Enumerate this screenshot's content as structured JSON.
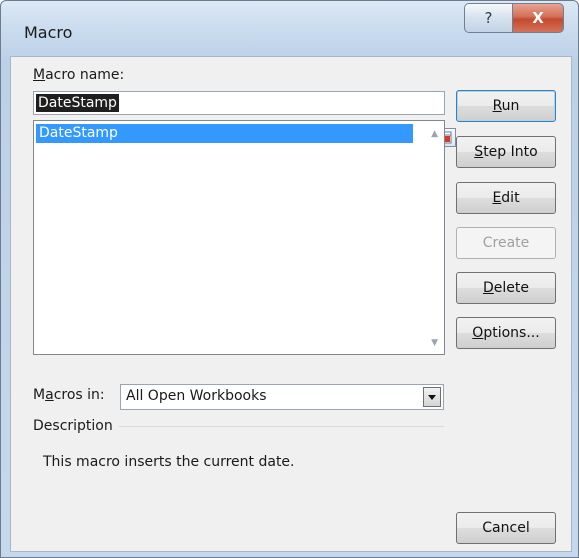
{
  "window": {
    "title": "Macro"
  },
  "titlebar": {
    "help_glyph": "?",
    "close_glyph": "X"
  },
  "form": {
    "macro_name_label_pre": "",
    "macro_name_label_ul": "M",
    "macro_name_label_post": "acro name:",
    "macro_name_value": "DateStamp",
    "macro_list": [
      "DateStamp"
    ],
    "macros_in_label_pre": "M",
    "macros_in_label_ul": "a",
    "macros_in_label_post": "cros in:",
    "macros_in_value": "All Open Workbooks",
    "description_label": "Description",
    "description_text": "This macro inserts the current date."
  },
  "buttons": {
    "run": {
      "pre": "",
      "ul": "R",
      "post": "un"
    },
    "step_into": {
      "pre": "",
      "ul": "S",
      "post": "tep Into"
    },
    "edit": {
      "pre": "",
      "ul": "E",
      "post": "dit"
    },
    "create": {
      "label": "Create"
    },
    "delete": {
      "pre": "",
      "ul": "D",
      "post": "elete"
    },
    "options": {
      "pre": "",
      "ul": "O",
      "post": "ptions..."
    },
    "cancel": {
      "label": "Cancel"
    }
  },
  "colors": {
    "selection": "#3399ff",
    "close_red": "#c9482d",
    "titlebar": "#c9dbee"
  }
}
